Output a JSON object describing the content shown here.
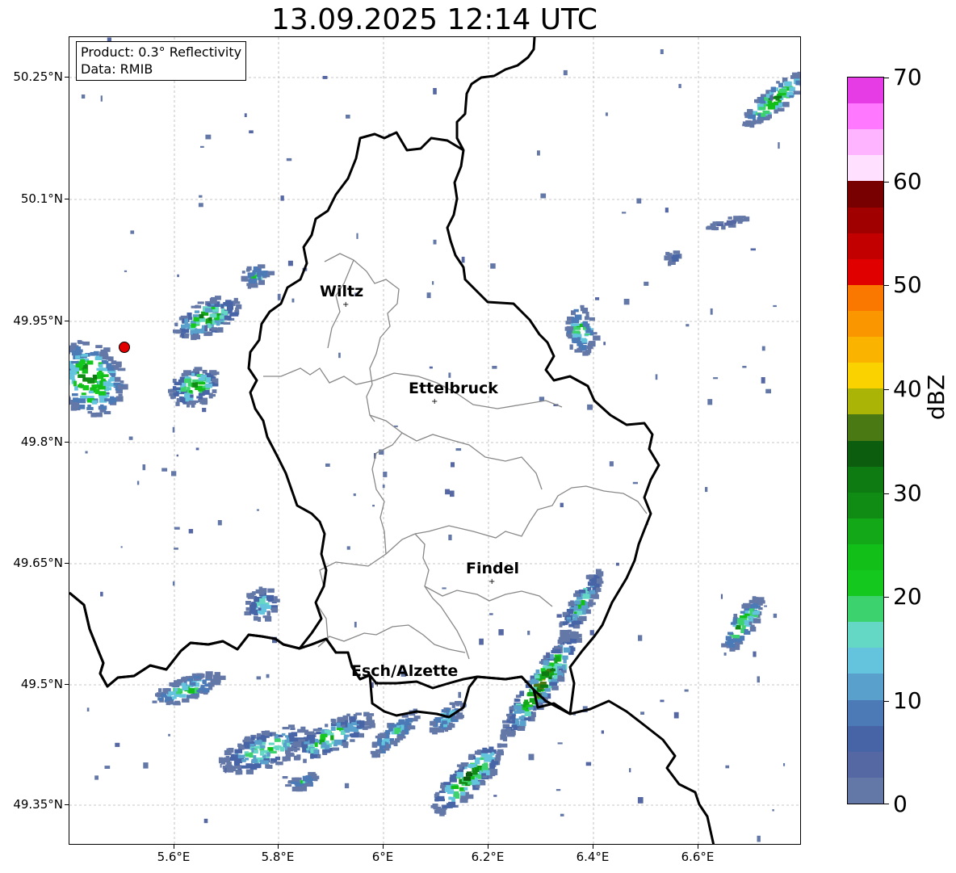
{
  "title": "13.09.2025 12:14 UTC",
  "info": {
    "product": "Product: 0.3° Reflectivity",
    "source": "Data: RMIB"
  },
  "axes": {
    "y_labels": [
      "50.25°N",
      "50.1°N",
      "49.95°N",
      "49.8°N",
      "49.65°N",
      "49.5°N",
      "49.35°N"
    ],
    "x_labels": [
      "5.6°E",
      "5.8°E",
      "6°E",
      "6.2°E",
      "6.4°E",
      "6.6°E"
    ]
  },
  "cities": [
    {
      "name": "Wiltz",
      "marker": "+"
    },
    {
      "name": "Ettelbruck",
      "marker": "+"
    },
    {
      "name": "Findel",
      "marker": "+"
    },
    {
      "name": "Esch/Alzette",
      "marker": "+"
    }
  ],
  "colorbar": {
    "unit": "dBZ",
    "tick_labels": [
      "70",
      "60",
      "50",
      "40",
      "30",
      "20",
      "10",
      "0"
    ],
    "range": [
      0,
      70
    ],
    "step": 2.5,
    "colors": [
      "#6478a8",
      "#5668a4",
      "#4664a6",
      "#4b7ab6",
      "#5aa0cc",
      "#64c4de",
      "#64d8c4",
      "#3cd26e",
      "#14c81e",
      "#12be18",
      "#12a818",
      "#108c14",
      "#0e7a12",
      "#0c5e0e",
      "#4a7812",
      "#aab406",
      "#fad200",
      "#fab400",
      "#fa9600",
      "#fa7800",
      "#e10000",
      "#c30000",
      "#a00000",
      "#780000",
      "#ffe1ff",
      "#ffb4ff",
      "#ff78ff",
      "#e63ce6"
    ]
  },
  "marker_color": "#e00000"
}
